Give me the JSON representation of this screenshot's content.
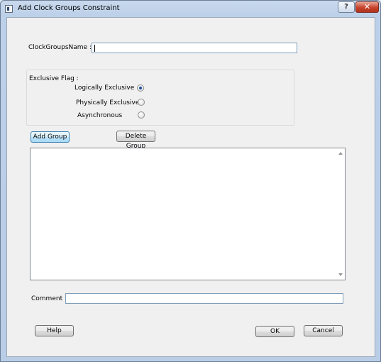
{
  "window": {
    "title": "Add Clock Groups Constraint",
    "help_button": "?",
    "close_button": "✕"
  },
  "form": {
    "name_label": "ClockGroupsName :",
    "name_value": "",
    "exclusive_flag_label": "Exclusive Flag :",
    "options": [
      {
        "label": "Logically Exclusive",
        "selected": true
      },
      {
        "label": "Physically Exclusive",
        "selected": false
      },
      {
        "label": "Asynchronous",
        "selected": false
      }
    ],
    "add_group_button": "Add Group",
    "delete_group_button": "Delete Group",
    "groups": [],
    "comment_label": "Comment :",
    "comment_value": ""
  },
  "footer": {
    "help_button": "Help",
    "ok_button": "OK",
    "cancel_button": "Cancel"
  }
}
